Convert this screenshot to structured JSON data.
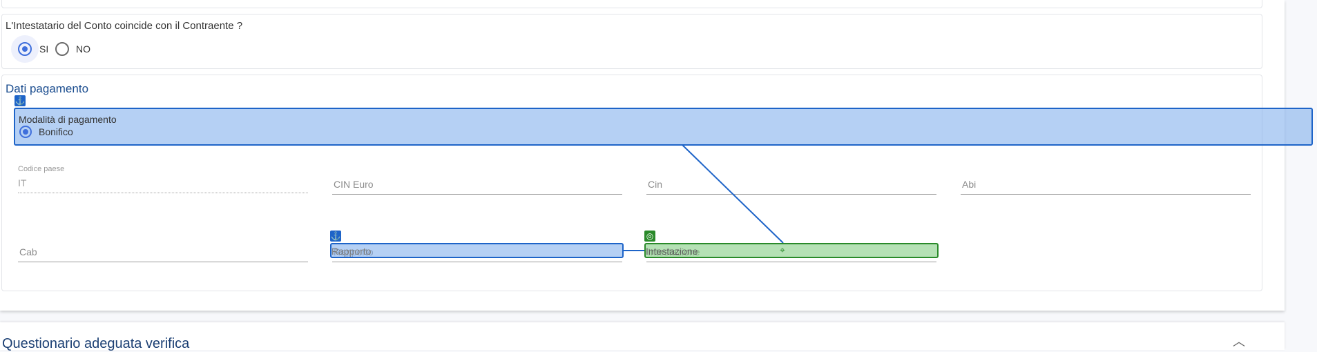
{
  "owner_question": {
    "text": "L'Intestatario del Conto coincide con il Contraente ?",
    "options": [
      {
        "label": "SI",
        "selected": true
      },
      {
        "label": "NO",
        "selected": false
      }
    ]
  },
  "payment": {
    "section_title": "Dati pagamento",
    "mode_label": "Modalità di pagamento",
    "mode_option": "Bonifico",
    "fields": {
      "country_code_label": "Codice paese",
      "country_code_value": "IT",
      "cin_euro": "CIN Euro",
      "cin": "Cin",
      "abi": "Abi",
      "cab": "Cab",
      "rapporto": "Rapporto",
      "intestazione": "Intestazione"
    }
  },
  "overlay": {
    "anchor_icon": "anchor-icon",
    "target_icon": "crosshair-icon",
    "blue": "#1e64c8",
    "green": "#2a8a2a"
  },
  "questionnaire": {
    "title": "Questionario adeguata verifica"
  }
}
